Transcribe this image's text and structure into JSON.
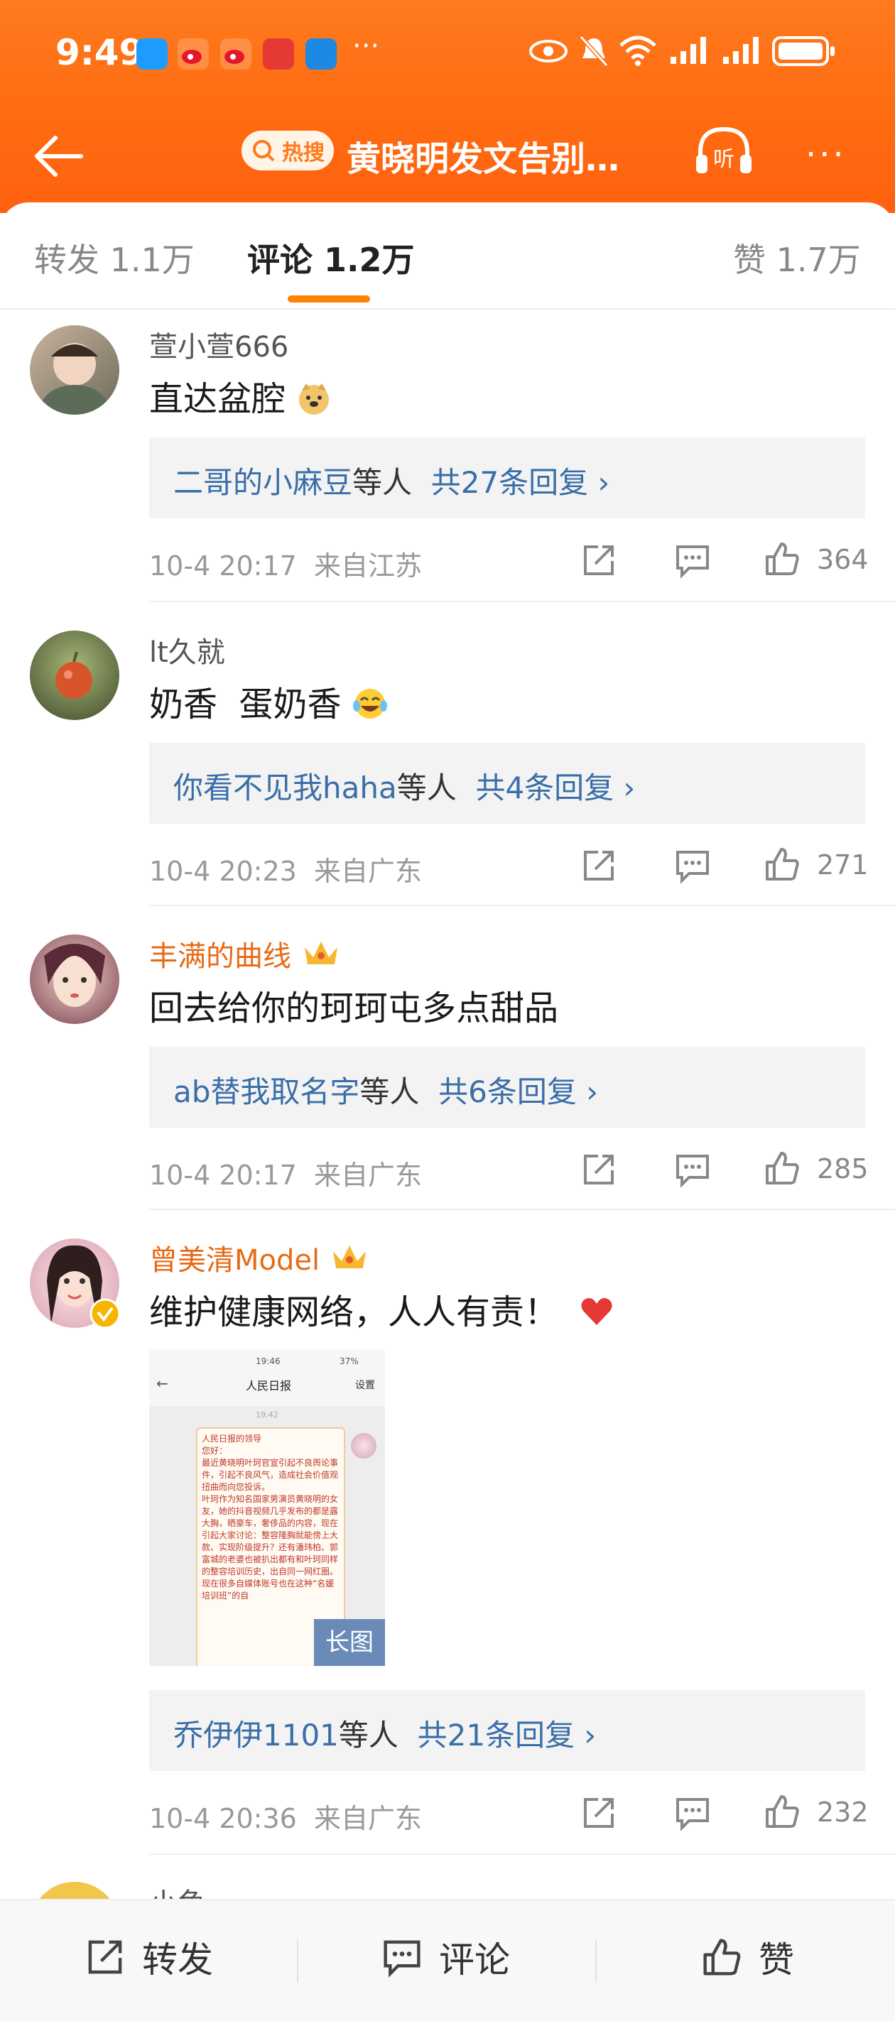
{
  "status_bar": {
    "time": "9:49",
    "more": "···"
  },
  "title_bar": {
    "hot_label": "热搜",
    "title": "黄晓明发文告别…",
    "listen_label": "听",
    "more": "···"
  },
  "tabs": [
    {
      "label": "转发 1.1万"
    },
    {
      "label": "评论 1.2万"
    },
    {
      "label": "赞 1.7万"
    }
  ],
  "comments": [
    {
      "user": "萱小萱666",
      "text": "直达盆腔",
      "emoji": "doge",
      "replies_from": "二哥的小麻豆",
      "replies_suffix": "等人",
      "replies_count": "共27条回复",
      "time": "10-4 20:17",
      "location": "来自江苏",
      "likes": "364"
    },
    {
      "user": "lt久就",
      "text": "奶香  蛋奶香",
      "emoji": "laugh-cry",
      "replies_from": "你看不见我haha",
      "replies_suffix": "等人",
      "replies_count": "共4条回复",
      "time": "10-4 20:23",
      "location": "来自广东",
      "likes": "271"
    },
    {
      "user": "丰满的曲线",
      "text": "回去给你的珂珂屯多点甜品",
      "replies_from": "ab替我取名字",
      "replies_suffix": "等人",
      "replies_count": "共6条回复",
      "time": "10-4 20:17",
      "location": "来自广东",
      "likes": "285"
    },
    {
      "user": "曾美清Model",
      "text": "维护健康网络，人人有责！",
      "emoji": "heart",
      "image_tag": "长图",
      "replies_from": "乔伊伊1101",
      "replies_suffix": "等人",
      "replies_count": "共21条回复",
      "time": "10-4 20:36",
      "location": "来自广东",
      "likes": "232"
    },
    {
      "user": "小鱼"
    }
  ],
  "embedded_screenshot": {
    "time": "19:46",
    "battery": "37%",
    "title": "人民日报",
    "settings": "设置",
    "msg_time": "19:42",
    "body": "人民日报的领导\n您好：\n最近黄晓明叶珂官宣引起不良舆论事件，引起不良风气，造成社会价值观扭曲而向您投诉。\n叶珂作为知名国家男演员黄晓明的女友，她的抖音视频几乎发布的都是露大胸，晒豪车，奢侈品的内容，现在引起大家讨论：整容隆胸就能傍上大款、实现阶级提升？还有潘玮柏、郭富城的老婆也被扒出都有和叶珂同样的整容培训历史，出自同一网红圈。\n现在很多自媒体账号也在这种“名媛培训班”的自"
  },
  "bottom_bar": {
    "repost": "转发",
    "comment": "评论",
    "like": "赞"
  },
  "colors": {
    "header": "#ff6a10",
    "accent": "#ff8200",
    "link": "#3a6ea8",
    "vip_name": "#e86a16"
  }
}
